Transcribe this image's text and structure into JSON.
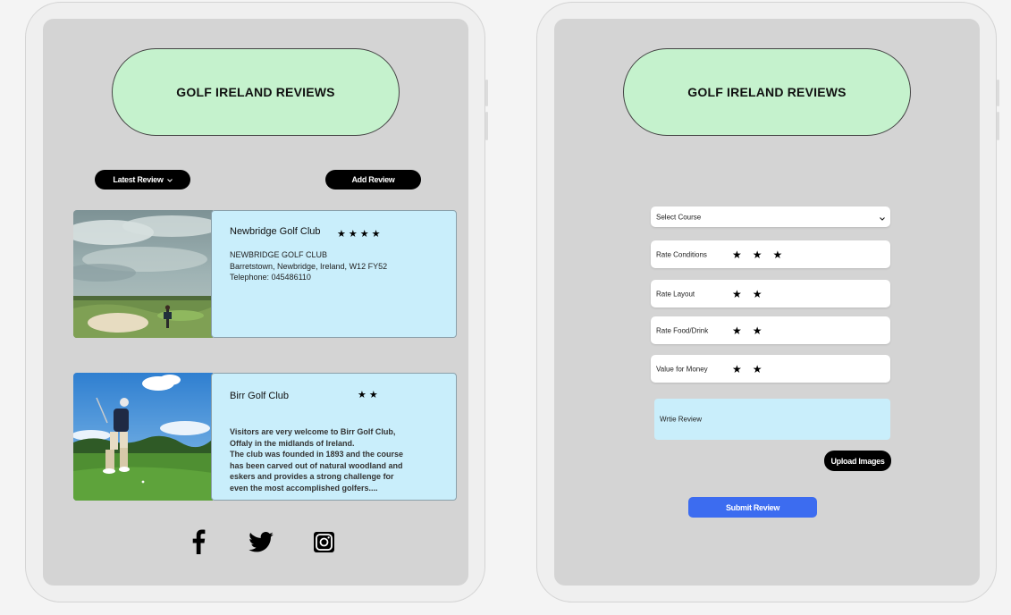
{
  "app_title": "GOLF IRELAND REVIEWS",
  "left_screen": {
    "latest_review_label": "Latest Review",
    "add_review_label": "Add Review",
    "cards": [
      {
        "title": "Newbridge Golf Club",
        "rating": 4,
        "stars": "★★★★",
        "text": "NEWBRIDGE GOLF CLUB\nBarretstown, Newbridge, Ireland, W12 FY52\nTelephone: 045486110"
      },
      {
        "title": "Birr Golf Club",
        "rating": 2,
        "stars": "★★",
        "text": "Visitors are very welcome to Birr Golf Club,\nOffaly in the midlands of Ireland.\nThe club was founded in 1893 and the course\nhas been carved out of natural woodland and\neskers and provides a strong challenge for\n even the most accomplished golfers...."
      }
    ],
    "social_icons": [
      "facebook-icon",
      "twitter-icon",
      "instagram-icon"
    ]
  },
  "right_screen": {
    "select_course_label": "Select Course",
    "ratings": [
      {
        "label": "Rate Conditions",
        "rating": 3,
        "stars": "★★★"
      },
      {
        "label": "Rate Layout",
        "rating": 2,
        "stars": "★★"
      },
      {
        "label": "Rate Food/Drink",
        "rating": 2,
        "stars": "★★"
      },
      {
        "label": "Value for Money",
        "rating": 2,
        "stars": "★★"
      }
    ],
    "review_placeholder": "Wrtie Review",
    "upload_label": "Upload Images",
    "submit_label": "Submit Review"
  },
  "colors": {
    "title_bg": "#c5f2cd",
    "card_bg": "#c9eefb",
    "submit_bg": "#3c6cf0",
    "screen_bg": "#d4d4d4"
  }
}
